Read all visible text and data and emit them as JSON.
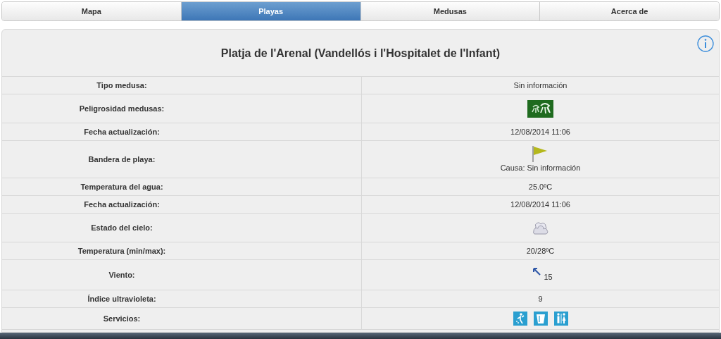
{
  "tabs": [
    {
      "label": "Mapa",
      "selected": false
    },
    {
      "label": "Playas",
      "selected": true
    },
    {
      "label": "Medusas",
      "selected": false
    },
    {
      "label": "Acerca de",
      "selected": false
    }
  ],
  "beach": {
    "title": "Platja de l'Arenal (Vandellós i l'Hospitalet de l'Infant)"
  },
  "rows": [
    {
      "label": "Tipo medusa:",
      "kind": "text",
      "value": "Sin información"
    },
    {
      "label": "Peligrosidad medusas:",
      "kind": "jellyfish"
    },
    {
      "label": "Fecha actualización:",
      "kind": "text",
      "value": "12/08/2014 11:06"
    },
    {
      "label": "Bandera de playa:",
      "kind": "flag",
      "value": "Causa: Sin información"
    },
    {
      "label": "Temperatura del agua:",
      "kind": "text",
      "value": "25.0ºC"
    },
    {
      "label": "Fecha actualización:",
      "kind": "text",
      "value": "12/08/2014 11:06"
    },
    {
      "label": "Estado del cielo:",
      "kind": "sky"
    },
    {
      "label": "Temperatura (min/max):",
      "kind": "text",
      "value": "20/28ºC"
    },
    {
      "label": "Viento:",
      "kind": "wind",
      "value": "15"
    },
    {
      "label": "Índice ultravioleta:",
      "kind": "text",
      "value": "9"
    },
    {
      "label": "Servicios:",
      "kind": "services"
    }
  ]
}
